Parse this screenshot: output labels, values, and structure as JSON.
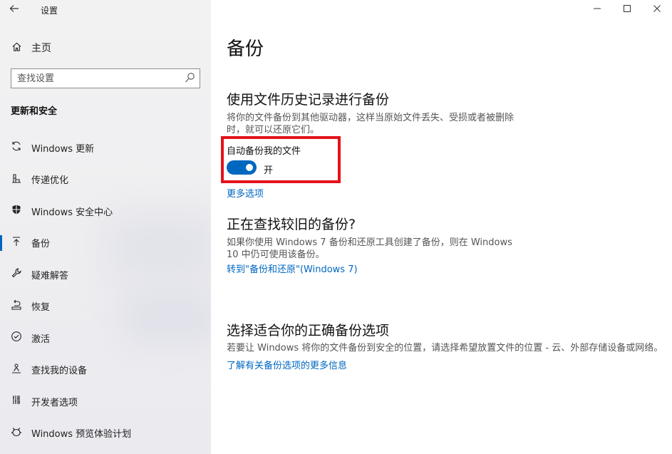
{
  "window": {
    "app_title": "设置",
    "back_icon": "back-arrow-icon",
    "minimize": "—",
    "maximize": "☐",
    "close": "✕"
  },
  "sidebar": {
    "home_label": "主页",
    "search_placeholder": "查找设置",
    "section_title": "更新和安全",
    "items": [
      {
        "label": "Windows 更新",
        "icon": "sync-icon"
      },
      {
        "label": "传递优化",
        "icon": "delivery-optimization-icon"
      },
      {
        "label": "Windows 安全中心",
        "icon": "shield-icon"
      },
      {
        "label": "备份",
        "icon": "backup-arrow-icon",
        "active": true
      },
      {
        "label": "疑难解答",
        "icon": "wrench-icon"
      },
      {
        "label": "恢复",
        "icon": "recovery-icon"
      },
      {
        "label": "激活",
        "icon": "check-circle-icon"
      },
      {
        "label": "查找我的设备",
        "icon": "person-locate-icon"
      },
      {
        "label": "开发者选项",
        "icon": "developer-icon"
      },
      {
        "label": "Windows 预览体验计划",
        "icon": "insider-icon"
      }
    ]
  },
  "main": {
    "title": "备份",
    "file_history": {
      "heading": "使用文件历史记录进行备份",
      "description": "将你的文件备份到其他驱动器，这样当原始文件丢失、受损或者被删除时，就可以还原它们。",
      "toggle_label": "自动备份我的文件",
      "toggle_state": "开",
      "toggle_on": true,
      "more_options": "更多选项"
    },
    "older_backup": {
      "heading": "正在查找较旧的备份?",
      "description": "如果你使用 Windows 7 备份和还原工具创建了备份，则在 Windows 10 中仍可使用该备份。",
      "link": "转到\"备份和还原\"(Windows 7)"
    },
    "choose_option": {
      "heading": "选择适合你的正确备份选项",
      "description": "若要让 Windows 将你的文件备份到安全的位置，请选择希望放置文件的位置 - 云、外部存储设备或网络。",
      "link": "了解有关备份选项的更多信息"
    }
  },
  "colors": {
    "accent": "#0067c0",
    "highlight": "#e3131b"
  }
}
